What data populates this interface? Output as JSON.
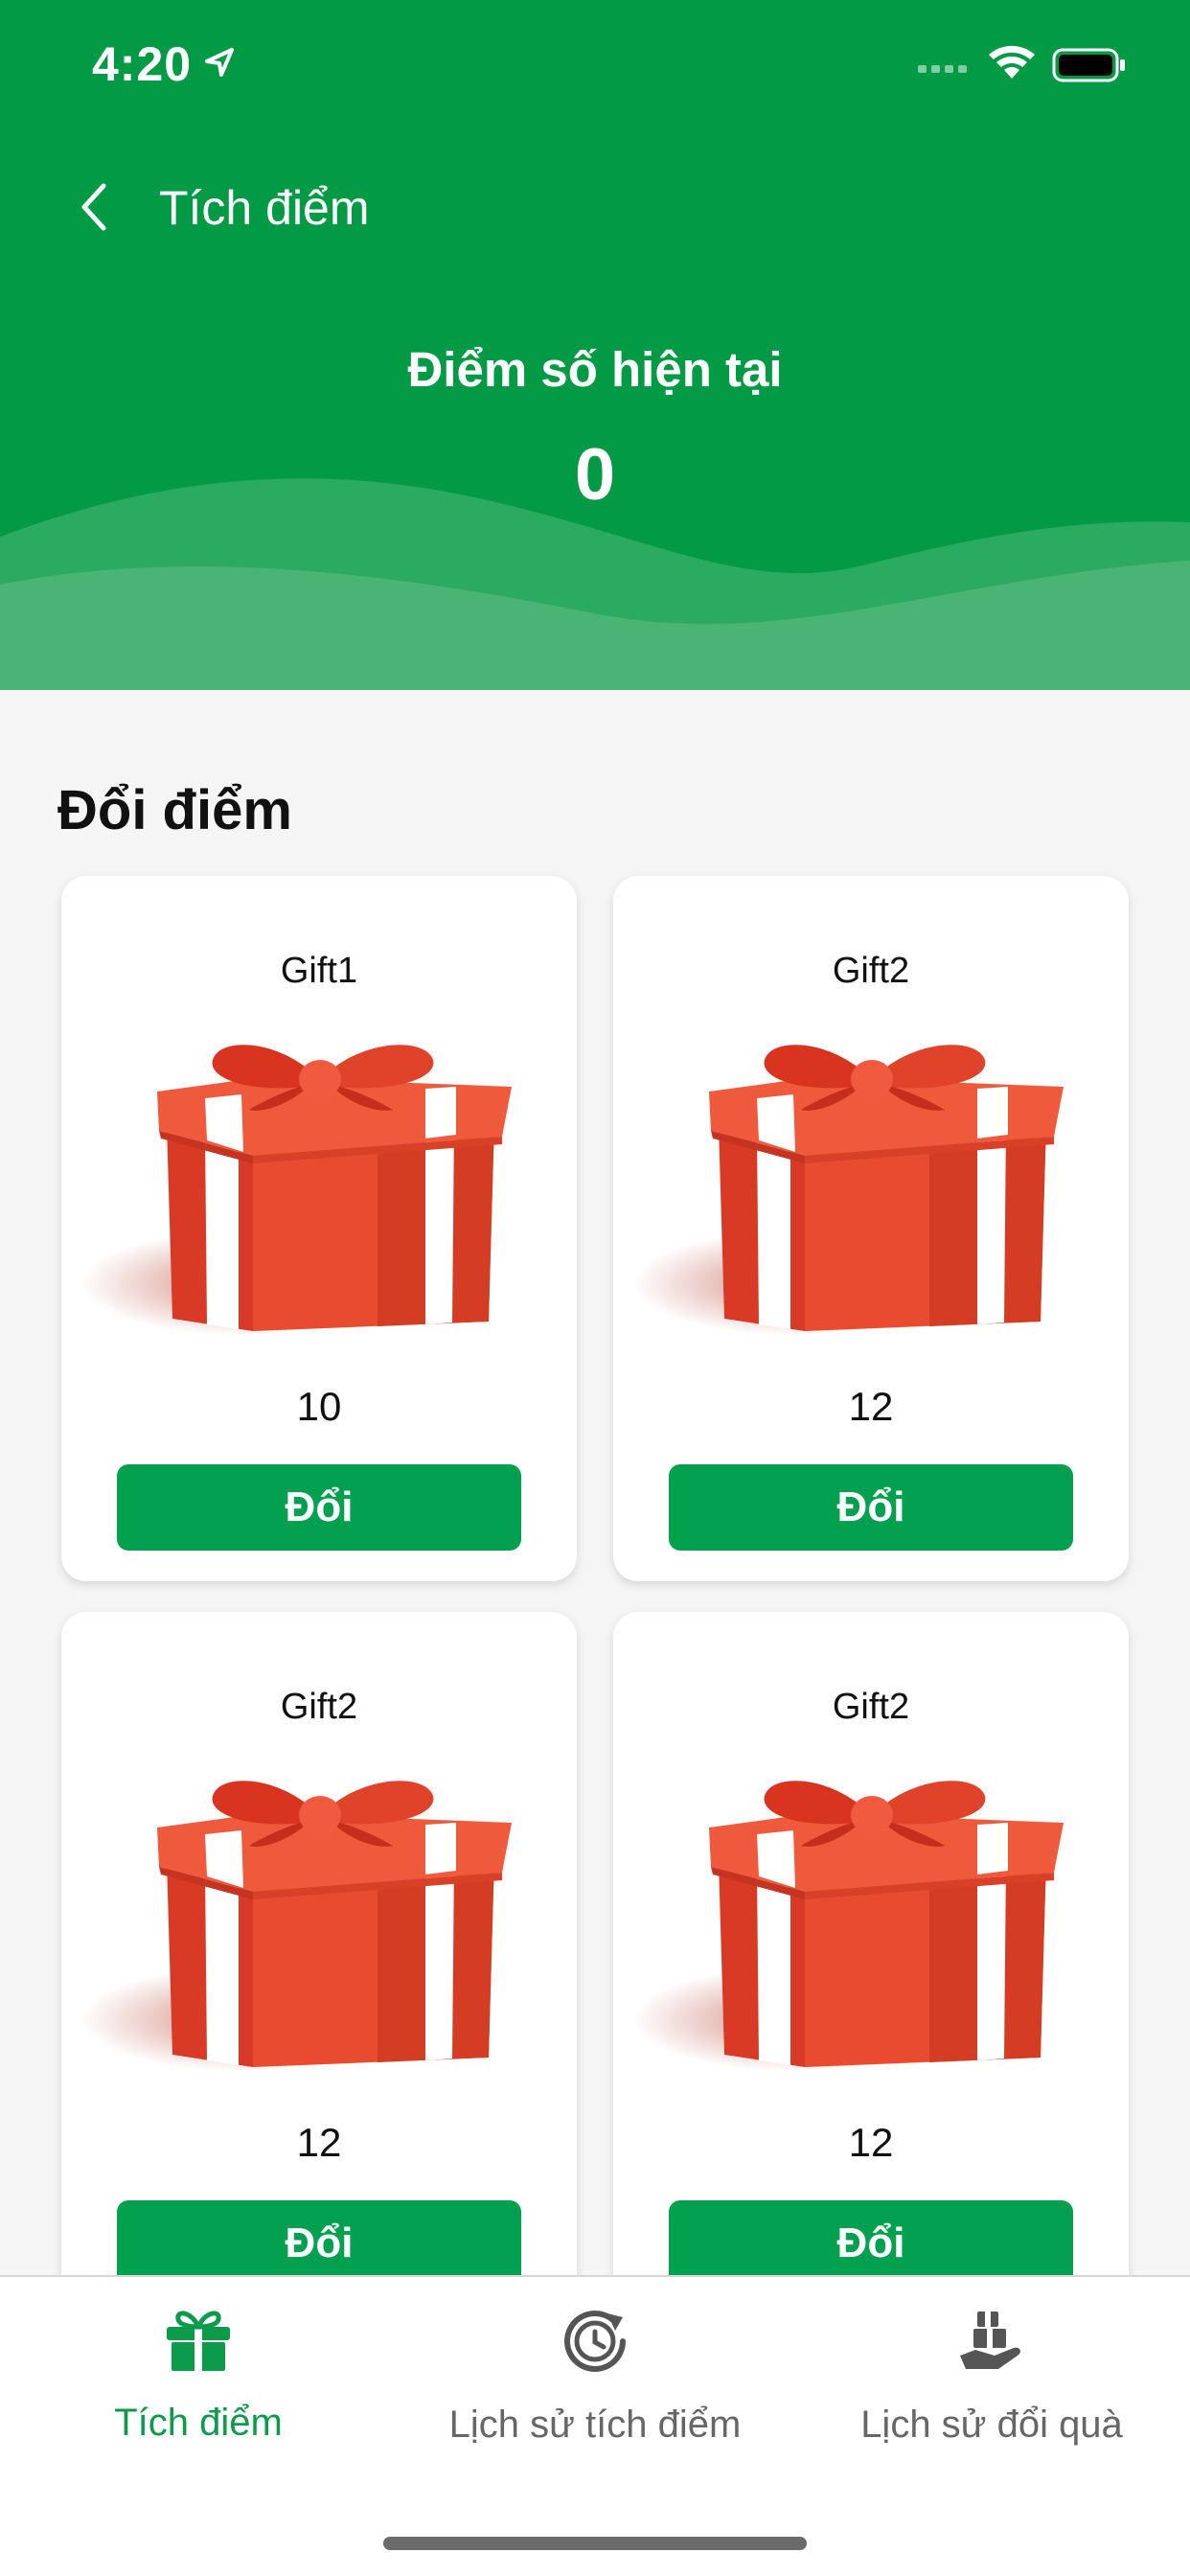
{
  "status_bar": {
    "time": "4:20"
  },
  "header": {
    "title": "Tích điểm",
    "points_label": "Điểm số hiện tại",
    "points_value": "0"
  },
  "section": {
    "title": "Đổi điểm"
  },
  "gifts": [
    {
      "name": "Gift1",
      "points": "10",
      "button": "Đổi"
    },
    {
      "name": "Gift2",
      "points": "12",
      "button": "Đổi"
    },
    {
      "name": "Gift2",
      "points": "12",
      "button": "Đổi"
    },
    {
      "name": "Gift2",
      "points": "12",
      "button": "Đổi"
    }
  ],
  "tabbar": {
    "tabs": [
      {
        "label": "Tích điểm",
        "icon": "gift-icon",
        "active": true
      },
      {
        "label": "Lịch sử tích điểm",
        "icon": "history-clock-icon",
        "active": false
      },
      {
        "label": "Lịch sử đổi quà",
        "icon": "gift-hand-icon",
        "active": false
      }
    ]
  },
  "colors": {
    "primary_green": "#029a44",
    "button_green": "#03a14f",
    "active_tab": "#0b9b4a",
    "background": "#f5f5f5"
  }
}
